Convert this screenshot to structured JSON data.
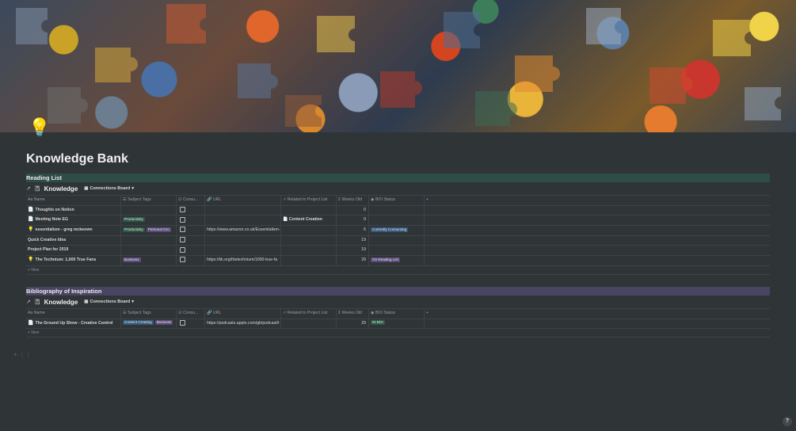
{
  "page": {
    "title": "Knowledge Bank",
    "icon": "💡"
  },
  "sections": [
    {
      "title": "Reading List",
      "bar_color": "#2e4d44",
      "database": {
        "title": "Knowledge",
        "view": "Connections Board"
      },
      "columns": [
        "Name",
        "Subject Tags",
        "Consu...",
        "URL",
        "Related to Project List",
        "Weeks Old",
        "BOI Status",
        "+"
      ],
      "rows": [
        {
          "icon": "📄",
          "name": "Thoughts on Notion",
          "tags": [],
          "url": "",
          "related": "",
          "weeks": "0",
          "status": []
        },
        {
          "icon": "📄",
          "name": "Meeting Note EG",
          "tags": [
            {
              "label": "Productivity",
              "color": "green"
            }
          ],
          "url": "",
          "related": "Content Creation",
          "weeks": "0",
          "status": []
        },
        {
          "icon": "💡",
          "name": "essentialism - greg mckeown",
          "tags": [
            {
              "label": "Productivity",
              "color": "green"
            },
            {
              "label": "Personal Gro",
              "color": "purple"
            }
          ],
          "url": "https://www.amazon.co.uk/Essentialism-",
          "related": "",
          "weeks": "6",
          "status": [
            {
              "label": "Currently Consuming",
              "color": "blue"
            }
          ]
        },
        {
          "icon": "",
          "name": "Quick Creative Idea",
          "tags": [],
          "url": "",
          "related": "",
          "weeks": "19",
          "status": []
        },
        {
          "icon": "",
          "name": "Project Plan for 2019",
          "tags": [],
          "url": "",
          "related": "",
          "weeks": "19",
          "status": []
        },
        {
          "icon": "💡",
          "name": "The Technium: 1,000 True Fans",
          "tags": [
            {
              "label": "Business",
              "color": "purple"
            }
          ],
          "url": "https://kk.org/thetechnium/1000-true-fa",
          "related": "",
          "weeks": "29",
          "status": [
            {
              "label": "On Reading List",
              "color": "purple"
            }
          ]
        }
      ],
      "new_label": "New"
    },
    {
      "title": "Bibliography of Inspiration",
      "bar_color": "#4a4463",
      "database": {
        "title": "Knowledge",
        "view": "Connections Board"
      },
      "columns": [
        "Name",
        "Subject Tags",
        "Consu...",
        "URL",
        "Related to Project List",
        "Weeks Old",
        "BOI Status",
        "+"
      ],
      "rows": [
        {
          "icon": "📄",
          "name": "The Ground Up Show - Creative Control",
          "tags": [
            {
              "label": "Content Creating",
              "color": "blue"
            },
            {
              "label": "Business",
              "color": "purple"
            }
          ],
          "url": "https://podcasts.apple.com/gb/podcast/t",
          "related": "",
          "weeks": "29",
          "status": [
            {
              "label": "IN BOI",
              "color": "green"
            }
          ]
        }
      ],
      "new_label": "New"
    }
  ],
  "help_label": "?"
}
